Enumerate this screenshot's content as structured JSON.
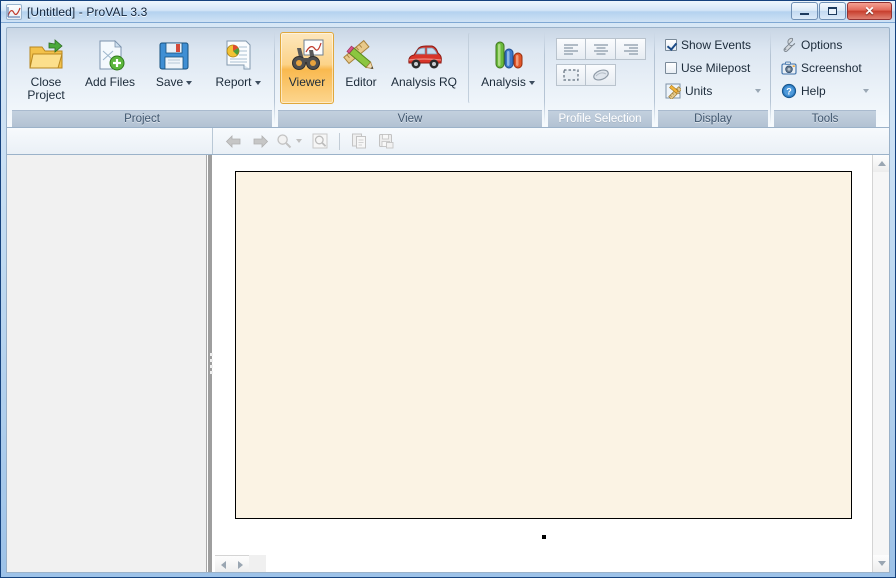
{
  "window": {
    "title": "[Untitled] - ProVAL 3.3",
    "app_icon": "proval-chart-icon",
    "controls": {
      "minimize": "minimize-button",
      "maximize": "maximize-button",
      "close": "close-button",
      "close_glyph": "✕"
    }
  },
  "ribbon": {
    "groups": [
      {
        "name": "project",
        "label": "Project",
        "disabled": false,
        "buttons": [
          {
            "name": "close-project",
            "label": "Close Project",
            "icon": "open-folder-icon",
            "has_dropdown": false
          },
          {
            "name": "add-files",
            "label": "Add Files",
            "icon": "document-add-icon",
            "has_dropdown": false
          },
          {
            "name": "save",
            "label": "Save",
            "icon": "floppy-disk-icon",
            "has_dropdown": true
          },
          {
            "name": "report",
            "label": "Report",
            "icon": "report-chart-icon",
            "has_dropdown": true
          }
        ]
      },
      {
        "name": "view",
        "label": "View",
        "disabled": false,
        "buttons": [
          {
            "name": "viewer",
            "label": "Viewer",
            "icon": "binoculars-icon",
            "has_dropdown": false,
            "selected": true
          },
          {
            "name": "editor",
            "label": "Editor",
            "icon": "pencil-ruler-icon",
            "has_dropdown": false
          },
          {
            "name": "analysis-rq",
            "label": "Analysis RQ",
            "icon": "red-car-icon",
            "has_dropdown": false
          },
          {
            "name": "analysis",
            "label": "Analysis",
            "icon": "bar-chart-icon",
            "has_dropdown": true
          }
        ]
      },
      {
        "name": "profile-selection",
        "label": "Profile Selection",
        "disabled": true,
        "tool_buttons": [
          {
            "name": "align-left",
            "icon": "align-left-icon"
          },
          {
            "name": "align-center",
            "icon": "align-center-icon"
          },
          {
            "name": "align-right",
            "icon": "align-right-icon"
          },
          {
            "name": "marquee-select",
            "icon": "dashed-selection-icon"
          },
          {
            "name": "erase-selection",
            "icon": "eraser-icon"
          }
        ]
      },
      {
        "name": "display",
        "label": "Display",
        "disabled": false,
        "items": [
          {
            "name": "show-events",
            "label": "Show Events",
            "type": "checkbox",
            "checked": true
          },
          {
            "name": "use-milepost",
            "label": "Use Milepost",
            "type": "checkbox",
            "checked": false
          },
          {
            "name": "units",
            "label": "Units",
            "type": "menu",
            "icon": "ruler-pencil-icon",
            "has_dropdown": true
          }
        ]
      },
      {
        "name": "tools",
        "label": "Tools",
        "disabled": false,
        "items": [
          {
            "name": "options",
            "label": "Options",
            "type": "button",
            "icon": "wrench-icon",
            "has_dropdown": false
          },
          {
            "name": "screenshot",
            "label": "Screenshot",
            "type": "button",
            "icon": "camera-icon",
            "has_dropdown": false
          },
          {
            "name": "help",
            "label": "Help",
            "type": "menu",
            "icon": "help-question-icon",
            "has_dropdown": true
          }
        ]
      }
    ]
  },
  "toolbar": {
    "buttons": [
      {
        "name": "navigate-back",
        "icon": "arrow-left-icon",
        "disabled": true
      },
      {
        "name": "navigate-forward",
        "icon": "arrow-right-icon",
        "disabled": true
      },
      {
        "name": "zoom",
        "icon": "magnifier-icon",
        "disabled": true,
        "has_dropdown": true
      },
      {
        "name": "zoom-to-selection",
        "icon": "magnifier-box-icon",
        "disabled": true
      },
      {
        "name": "copy",
        "icon": "copy-icon",
        "disabled": true
      },
      {
        "name": "save-image",
        "icon": "save-image-icon",
        "disabled": true
      }
    ]
  },
  "sidebar": {
    "name": "project-explorer-panel",
    "items": []
  },
  "viewport": {
    "name": "profile-viewer-canvas",
    "plot_background": "#fbf3e4",
    "plot_border": "#000000",
    "marker": "center-dot"
  },
  "scrollbars": {
    "vertical": {
      "up": "scroll-up-arrow",
      "down": "scroll-down-arrow"
    },
    "horizontal": {
      "left": "scroll-left-arrow",
      "right": "scroll-right-arrow"
    }
  },
  "colors": {
    "accent": "#2a5699",
    "selected_button": "#f9b94f",
    "ribbon_top": "#c9d6e5",
    "plot_cream": "#fbf3e4"
  }
}
